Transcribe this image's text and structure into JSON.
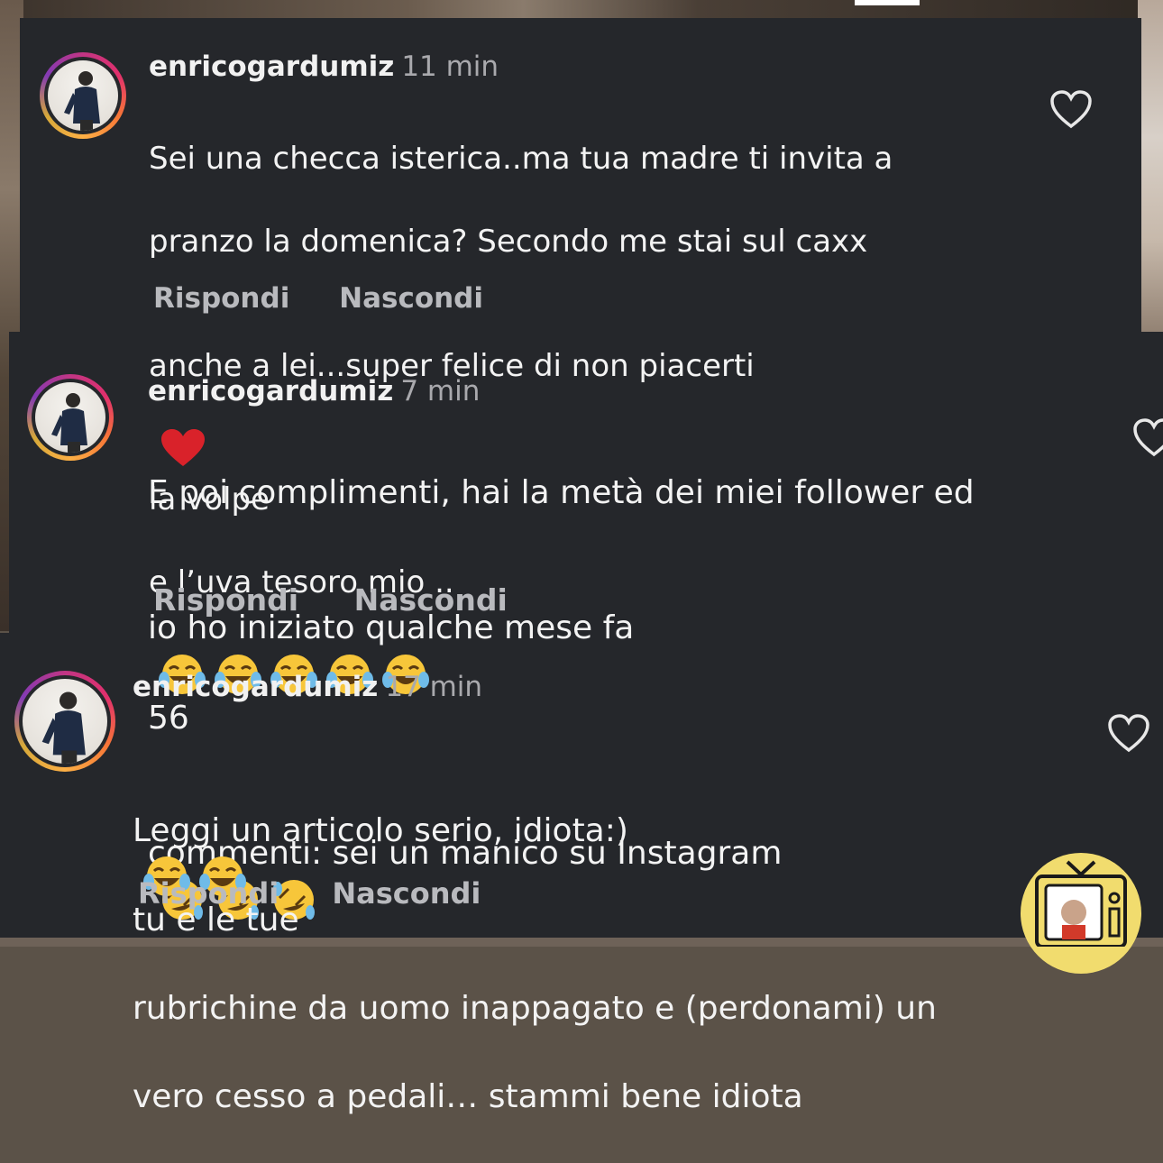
{
  "comments": [
    {
      "username": "enricogardumiz",
      "time": "11 min",
      "line1": "Sei una checca isterica..ma tua madre ti invita a",
      "line2": "pranzo la domenica? Secondo me stai sul caxx",
      "line3_a": "anche a lei...super felice di non piacerti",
      "line3_b": "la volpe",
      "line4": "e l’uva tesoro mio ..",
      "reply_label": "Rispondi",
      "hide_label": "Nascondi"
    },
    {
      "username": "enricogardumiz",
      "time": "7 min",
      "line1": "E poi complimenti, hai la metà dei miei follower ed",
      "line2_a": "io ho iniziato qualche mese fa",
      "line2_b": "56",
      "line3": "commenti: sei un manico su Instagram",
      "reply_label": "Rispondi",
      "hide_label": "Nascondi"
    },
    {
      "username": "enricogardumiz",
      "time": "17 min",
      "line1_a": "Leggi un articolo serio, idiota:)",
      "line1_b": "tu e le tue",
      "line2": "rubrichine da uomo inappagato e (perdonami) un",
      "line3": "vero cesso a pedali… stammi bene idiota",
      "reply_label": "Rispondi",
      "hide_label": "Nascondi"
    }
  ],
  "colors": {
    "panel": "#25272b",
    "text": "#f3f3f3",
    "muted": "#a9a9ad",
    "heart_emoji": "#d9222a",
    "emoji_face": "#f7c63a"
  },
  "icons": [
    "heart-outline-icon",
    "red-heart-emoji",
    "tears-of-joy-emoji",
    "rolling-laughing-emoji",
    "tv-logo-icon"
  ]
}
